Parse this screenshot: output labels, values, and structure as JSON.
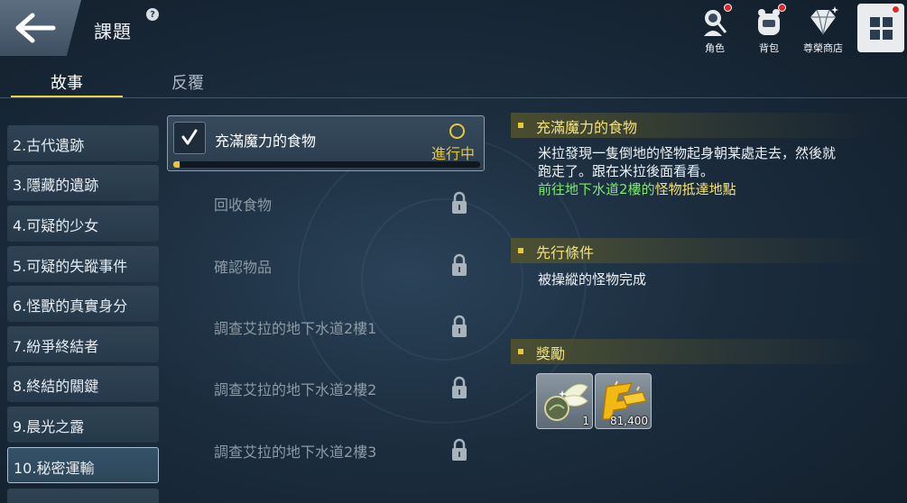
{
  "header": {
    "title": "課題",
    "help_glyph": "?",
    "buttons": [
      {
        "label": "角色",
        "icon": "character-icon",
        "has_notification": true
      },
      {
        "label": "背包",
        "icon": "bag-icon",
        "has_notification": true
      },
      {
        "label": "尊榮商店",
        "icon": "diamond-icon",
        "has_notification": false
      }
    ],
    "menu_notification": true
  },
  "tabs": [
    {
      "label": "故事",
      "active": true
    },
    {
      "label": "反覆",
      "active": false
    }
  ],
  "chapters": [
    {
      "label": "2.古代遺跡"
    },
    {
      "label": "3.隱藏的遺跡"
    },
    {
      "label": "4.可疑的少女"
    },
    {
      "label": "5.可疑的失蹤事件"
    },
    {
      "label": "6.怪獸的真實身分"
    },
    {
      "label": "7.紛爭終結者"
    },
    {
      "label": "8.終結的關鍵"
    },
    {
      "label": "9.晨光之露"
    },
    {
      "label": "10.秘密運輸",
      "selected": true
    }
  ],
  "quests": {
    "active": {
      "name": "充滿魔力的食物",
      "status": "進行中",
      "progress": 0.02
    },
    "locked": [
      {
        "name": "回收食物"
      },
      {
        "name": "確認物品"
      },
      {
        "name": "調查艾拉的地下水道2樓1"
      },
      {
        "name": "調查艾拉的地下水道2樓2"
      },
      {
        "name": "調查艾拉的地下水道2樓3"
      }
    ]
  },
  "detail": {
    "quest_title": "充滿魔力的食物",
    "description_line1": "米拉發現一隻倒地的怪物起身朝某處走去，然後就",
    "description_line2": "跑走了。跟在米拉後面看看。",
    "objective_prefix": "前往",
    "objective_location": "地下水道2樓",
    "objective_middle": "的",
    "objective_target": "怪物抵達地點",
    "prereq_title": "先行條件",
    "prereq_text": "被操縱的怪物完成",
    "reward_title": "獎勵",
    "rewards": [
      {
        "item": "winged-orb-item",
        "quantity": "1"
      },
      {
        "item": "gold-currency",
        "quantity": "81,400"
      }
    ]
  },
  "colors": {
    "accent_yellow": "#e9c73a",
    "highlight_green": "#7de86a",
    "notification_red": "#e02626"
  }
}
